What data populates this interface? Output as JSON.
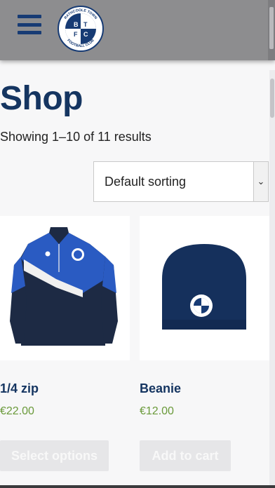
{
  "header": {
    "menu_icon": "hamburger-icon",
    "logo": {
      "top_text": "RATHCOOLE TOWN",
      "bottom_text": "FOOTBALL CLUB",
      "letters": [
        "B",
        "T",
        "F",
        "C"
      ],
      "colors": [
        "#173b74",
        "#ffffff"
      ]
    }
  },
  "shop": {
    "title": "Shop",
    "result_count": "Showing 1–10 of 11 results",
    "sort": {
      "selected": "Default sorting",
      "icon": "chevron-down-icon"
    }
  },
  "products": [
    {
      "name": "1/4 zip",
      "price": "€22.00",
      "button": "Select options",
      "image": "quarter-zip-top"
    },
    {
      "name": "Beanie",
      "price": "€12.00",
      "button": "Add to cart",
      "image": "beanie-hat"
    }
  ],
  "colors": {
    "brand_navy": "#153561",
    "price_green": "#6a9a3a",
    "header_gray": "#8d8d8f"
  }
}
